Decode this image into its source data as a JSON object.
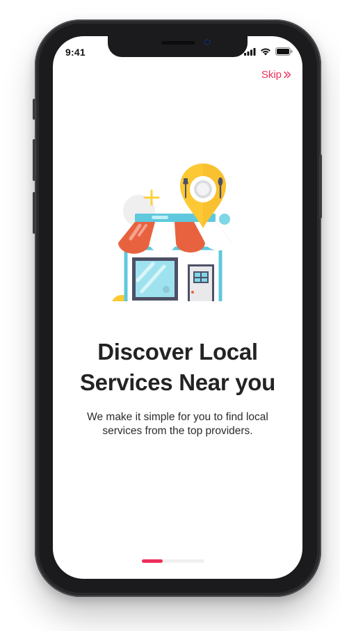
{
  "status_bar": {
    "time": "9:41"
  },
  "skip": {
    "label": "Skip",
    "icon": "chevrons-right-icon"
  },
  "onboarding": {
    "title_line1": "Discover Local",
    "title_line2": "Services Near you",
    "subtitle_line1": "We make it simple for you to find local",
    "subtitle_line2": "services from the top providers."
  },
  "pager": {
    "current": 1,
    "progress": 0.33
  },
  "colors": {
    "accent": "#ee2e59",
    "awning_red": "#e8623f",
    "shop_teal": "#5fc8dc",
    "pin_yellow": "#fcc934",
    "base_dark": "#4d5066"
  }
}
